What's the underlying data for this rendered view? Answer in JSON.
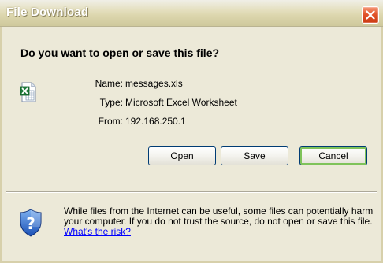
{
  "window": {
    "title": "File Download"
  },
  "dialog": {
    "question": "Do you want to open or save this file?",
    "file": {
      "name_label": "Name:",
      "name_value": "messages.xls",
      "type_label": "Type:",
      "type_value": "Microsoft Excel Worksheet",
      "from_label": "From:",
      "from_value": "192.168.250.1",
      "icon": "excel-file-icon"
    },
    "buttons": {
      "open": "Open",
      "save": "Save",
      "cancel": "Cancel"
    },
    "warning": {
      "icon": "shield-icon",
      "text_before": "While files from the Internet can be useful, some files can potentially harm your computer. If you do not trust the source, do not open or save this file. ",
      "link": "What's the risk?"
    }
  },
  "colors": {
    "dialog_background": "#ece9d8",
    "close_button": "#e2542a",
    "link": "#0000ff",
    "button_border": "#003c74"
  }
}
